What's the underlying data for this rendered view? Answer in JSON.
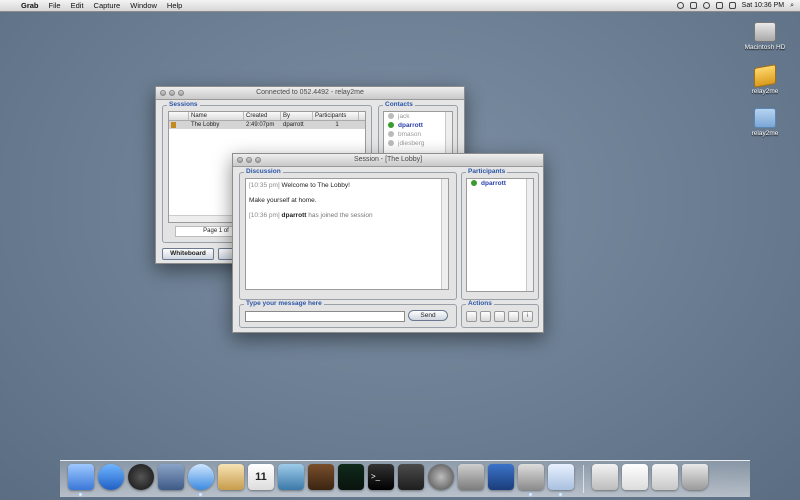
{
  "menubar": {
    "app": "Grab",
    "items": [
      "File",
      "Edit",
      "Capture",
      "Window",
      "Help"
    ],
    "clock": "Sat 10:36 PM"
  },
  "desktop": {
    "icons": [
      "Macintosh HD",
      "relay2me",
      "relay2me"
    ]
  },
  "main_window": {
    "title": "Connected to 052.4492 - relay2me",
    "sessions": {
      "label": "Sessions",
      "columns": [
        "Name",
        "Created",
        "By",
        "Participants"
      ],
      "rows": [
        {
          "name": "The Lobby",
          "created": "2:49:07pm",
          "by": "dparrott",
          "participants": "1"
        }
      ],
      "pager": "Page 1 of"
    },
    "contacts": {
      "label": "Contacts",
      "items": [
        {
          "name": "jack",
          "online": false
        },
        {
          "name": "dparrott",
          "online": true
        },
        {
          "name": "bmason",
          "online": false
        },
        {
          "name": "jdiesberg",
          "online": false
        }
      ]
    },
    "whiteboard_button": "Whiteboard"
  },
  "session_window": {
    "title": "Session - [The Lobby]",
    "discussion_label": "Discussion",
    "messages": [
      {
        "time": "[10:35 pm]",
        "text": "Welcome to The Lobby!"
      },
      {
        "text": "Make yourself at home."
      },
      {
        "time": "[10:36 pm]",
        "user": "dparrott",
        "text": "has joined the session"
      }
    ],
    "participants_label": "Participants",
    "participants": [
      "dparrott"
    ],
    "compose_label": "Type your message here",
    "send_label": "Send",
    "actions_label": "Actions"
  }
}
